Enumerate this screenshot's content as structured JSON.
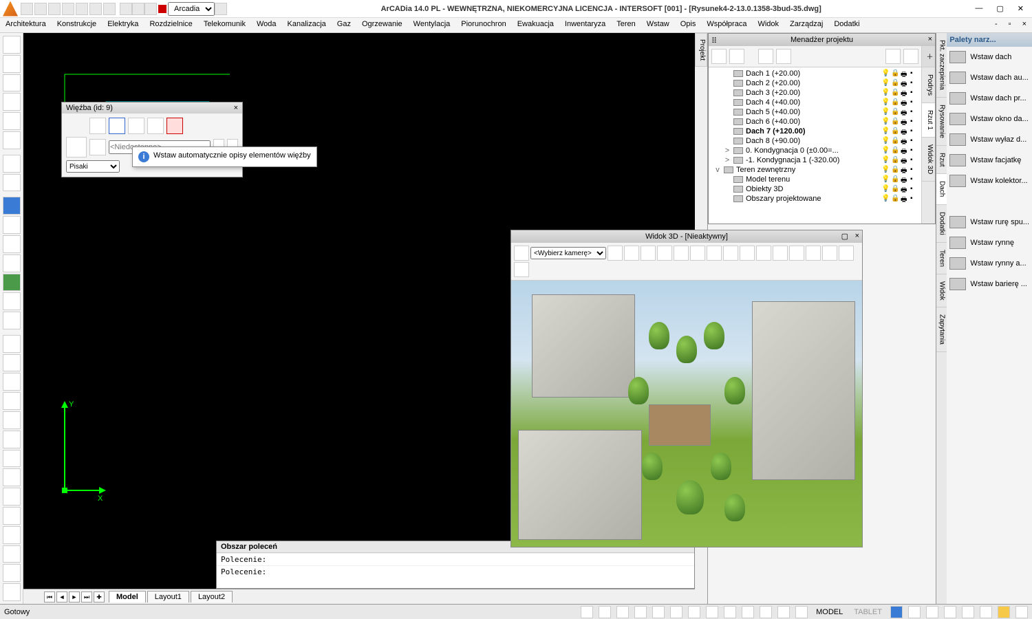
{
  "titlebar": {
    "scheme": "Arcadia",
    "title": "ArCADia 14.0 PL - WEWNĘTRZNA, NIEKOMERCYJNA LICENCJA - INTERSOFT [001] - [Rysunek4-2-13.0.1358-3bud-35.dwg]"
  },
  "menubar": [
    "Architektura",
    "Konstrukcje",
    "Elektryka",
    "Rozdzielnice",
    "Telekomunik",
    "Woda",
    "Kanalizacja",
    "Gaz",
    "Ogrzewanie",
    "Wentylacja",
    "Piorunochron",
    "Ewakuacja",
    "Inwentaryza",
    "Teren",
    "Wstaw",
    "Opis",
    "Współpraca",
    "Widok",
    "Zarządzaj",
    "Dodatki"
  ],
  "floating": {
    "title": "Więźba (id: 9)",
    "pisaki_label": "Pisaki",
    "input_placeholder": "<Niedostępne>",
    "tooltip": "Wstaw automatycznie opisy elementów więźby"
  },
  "project_manager": {
    "title": "Menadżer projektu",
    "side_tabs_left": [
      "Projekt"
    ],
    "side_tabs_right": [
      "Podrys",
      "Rzut 1",
      "Widok 3D"
    ],
    "tree": [
      {
        "exp": "",
        "icon": "roof",
        "label": "Dach 1 (+20.00)",
        "indent": 1
      },
      {
        "exp": "",
        "icon": "roof",
        "label": "Dach 2 (+20.00)",
        "indent": 1
      },
      {
        "exp": "",
        "icon": "roof",
        "label": "Dach 3 (+20.00)",
        "indent": 1
      },
      {
        "exp": "",
        "icon": "roof",
        "label": "Dach 4 (+40.00)",
        "indent": 1
      },
      {
        "exp": "",
        "icon": "roof",
        "label": "Dach 5 (+40.00)",
        "indent": 1
      },
      {
        "exp": "",
        "icon": "roof",
        "label": "Dach 6 (+40.00)",
        "indent": 1
      },
      {
        "exp": "",
        "icon": "roof",
        "label": "Dach 7 (+120.00)",
        "indent": 1,
        "selected": true
      },
      {
        "exp": "",
        "icon": "roof",
        "label": "Dach 8 (+90.00)",
        "indent": 1
      },
      {
        "exp": ">",
        "icon": "storey",
        "label": "0. Kondygnacja 0 (±0.00=...",
        "indent": 1
      },
      {
        "exp": ">",
        "icon": "storey",
        "label": "-1. Kondygnacja 1 (-320.00)",
        "indent": 1
      },
      {
        "exp": "v",
        "icon": "terrain",
        "label": "Teren zewnętrzny",
        "indent": 0
      },
      {
        "exp": "",
        "icon": "model",
        "label": "Model terenu",
        "indent": 1
      },
      {
        "exp": "",
        "icon": "obj3d",
        "label": "Obiekty 3D",
        "indent": 1
      },
      {
        "exp": "",
        "icon": "area",
        "label": "Obszary projektowane",
        "indent": 1
      }
    ]
  },
  "view3d": {
    "title": "Widok 3D - [Nieaktywny]",
    "camera_placeholder": "<Wybierz kamerę>"
  },
  "palette": {
    "title": "Palety narz...",
    "items": [
      "Wstaw dach",
      "Wstaw dach au...",
      "Wstaw dach pr...",
      "Wstaw okno da...",
      "Wstaw wyłaz d...",
      "Wstaw facjatkę",
      "Wstaw kolektor...",
      "Wstaw rurę spu...",
      "Wstaw rynnę",
      "Wstaw rynny a...",
      "Wstaw barierę ..."
    ],
    "tabs": [
      "Pkt. zaczepienia",
      "Rysowanie",
      "Rzut",
      "Dach",
      "Dodatki",
      "Teren",
      "Widok",
      "Zapytania"
    ]
  },
  "tabs": {
    "items": [
      "Model",
      "Layout1",
      "Layout2"
    ],
    "active": 0
  },
  "command": {
    "title": "Obszar poleceń",
    "prompt": "Polecenie:"
  },
  "statusbar": {
    "status": "Gotowy",
    "labels": [
      "MODEL",
      "TABLET"
    ]
  },
  "ucs": {
    "x": "X",
    "y": "Y"
  }
}
